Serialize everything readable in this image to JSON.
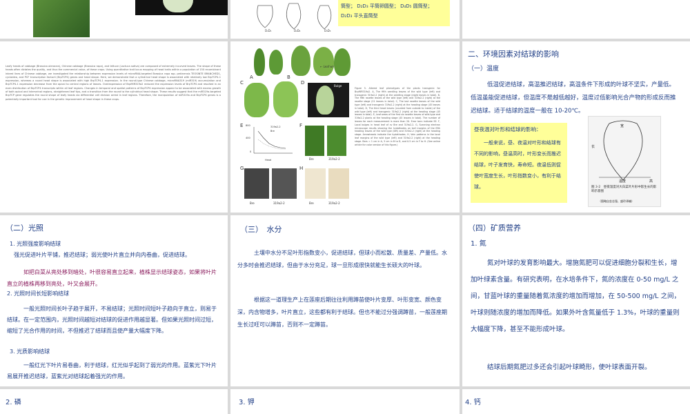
{
  "colors": {
    "title_blue": "#1f3e86",
    "body_blue": "#203880",
    "highlight": "#ffff99",
    "magenta": "#8a1b5c",
    "gray_bg": "#d9d9d9"
  },
  "top_strip": {
    "mid_lines": [
      "筒型；",
      "D₂D₃ 平筒卵圆型；",
      "D₄D₅ 圆筒型；"
    ],
    "mid_last": "D₂D₃ 平头直筒型",
    "head_labels": [
      "D₁D₁",
      "D₂D₂",
      "D₃D₃"
    ]
  },
  "abstract": {
    "text": "Leafy heads of cabbage (Brassica oleracea), Chinese cabbage (Brassica rapa), and lettuce (Lactuca sativa) are composed of extremely incurved leaves. The shape of these heads often dictates the quality, and thus the commercial value, of these crops. Using quantitative trait locus mapping of head traits within a population of 150 recombinant inbred lines of Chinese cabbage, we investigated the relationship between expression levels of microRNA-targeted Brassica rapa ssp. pekinensis TEOSINTE BRANCHED1, cycloidea, and PCF transcription factor4 (BrpTCP4) genes and head shape. Here, we demonstrate that a cylindrical head shape is associated with relatively low BrpTCP4-1 expression, whereas a round head shape is associated with high BrpTCP4-1 expression. In the round-type Chinese cabbage, microRNA319 (miR319) accumulation and BrpTCP4-1 expression decrease from the apical to central regions of leaves. Overexpression of BrpMIR319a2 reduced the expression levels of BrpTCP4 and resulted in an even distribution of BrpTCP4 transcripts within all leaf regions. Changes in temporal and spatial patterns of BrpTCP4 expression appear to be associated with excess growth of both apical and interveinal regions, straightened leaf tips, and a transition from the round to the cylindrical head shape. These results suggest that the miR319a-targeted BrpTCP gene regulates the round shape of leafy heads via differential cell division arrest in leaf regions. Therefore, the manipulation of miR319a and BrpTCP4 genes is a potentially important tool for use in the genetic improvement of head shape in these crops."
  },
  "figure": {
    "panel_letters": [
      "A",
      "B",
      "C",
      "D",
      "E",
      "F",
      "G",
      "H"
    ],
    "leaf_wing": "Leaf wing",
    "bulge": "Bulge",
    "vein": "Vein",
    "bre_label": "Bre",
    "mut_label": "319a2-2",
    "axis_y": "Leaf area (cm²)",
    "axis_x": "Head",
    "ticks_y": [
      "800",
      "600",
      "400",
      "200",
      "0"
    ],
    "ticks_x": [
      "1",
      "2",
      "3",
      "4",
      "5",
      "6"
    ],
    "legend": [
      "319a2-2",
      "Bre"
    ],
    "caption": "Figure 5. Altered leaf phenotypes of the plants transgenic for BrpMIR319a2. A, The fifth seedling leaves of the wild type (left) and transgenic 319a2-2 (right) at the seedling stage (eight leaves in total). B, The fifth rosette leaves of the wild type (left) and 319a2-2 (right) at the rosette stage (21 leaves in total). C, The last rosette leaves of the wild type (left) and transgenic 319a2-2 (right) at the heading stage (45 leaves in total). D, The third head leaves (counted from outside to inside) of the wild type (left) and transgenic 319a2-2 (right) at the heading stage (45 leaves in total). E, Leaf areas of the first six rosette leaves of wild-type and 319a2-2 plants at the heading stage (45 leaves in total). The number of leaves for each measurement is more than 20. Error bars indicate SE. F, Local bulges in head leaf of cv Bre and 319a2-2. G, Scanning electron microscope results showing the hydathodes on leaf margins of the fifth heading leaves of the wild type (left) and 319a2-2 (right) at the heading stage. Arrowheads indicate the hydathodes. H, Vein patterns in the local leaf margins of the wild type (left) and 319a2-2 (right) at the heading stage. Bars = 1 cm in A, 5 cm in B to D, and 0.5 cm in F to H. (See online article for color version of this figure.)"
  },
  "env": {
    "title": "二、环境因素对结球的影响",
    "subtitle": "（一）温度",
    "para": "低温促进结球，高温推迟结球，高温条件下形成的叶球不坚实，产量低。低温虽能促进结球，但温度不是越低越好，温度过低影响光合产物的形成反而推迟结球。适于结球的温度一般在 10-20℃。",
    "box_title": "昼夜温对叶形和结球的影响：",
    "box_text": "一般来说，昼、夜温对叶形和结球有不同的影响，昼温高时，叶形变长而推迟结球，叶子发育快，寿命短。夜温低则促使叶宽度生长，叶形指数变小，有利于结球。",
    "diagram_labels": [
      "长",
      "宽",
      "温度",
      "高"
    ],
    "diagram_caption": "图 3-2　昼夜温度对大白菜叶片形中影生长的影响示意图",
    "diagram_subcaption": "（图略自金志强、盛玲译编）"
  },
  "light": {
    "title": "（二）光照",
    "h1": "1. 光照强度影响结球",
    "p1": "强光促进叶片平铺，推迟结球；弱光使叶片直立并向内卷曲，促进结球。",
    "p_magenta": "如把白菜从亮处移到暗处，叶很容易直立起来，植株显示结球姿态，如果将叶片直立的植株再移到亮处，叶又会展开。",
    "h2": "2. 光照时间长短影响结球",
    "p2": "一般光照时间长叶子趋于展开，不易结球；光照时间短叶子趋向于直立，则易于结球。在一定范围内，光照时间越短对结球的促进作用越显著。但如果光照时间过短，缩短了光合作用的时间，不但推迟了结球而且使产量大幅度下降。",
    "h3": "3. 光质影响结球",
    "p3": "一般红光下叶片易卷曲，利于结球，红光似乎起到了弱光的作用。蓝紫光下叶片易展开推迟结球，蓝紫光对结球起着强光的作用。"
  },
  "water": {
    "title": "（三）　水分",
    "p1": "土壤中水分不足叶形指数变小，促进结球，但球小而松散、质量差、产量低。水分多时会推迟结球，但由于水分充足，球一旦形成很快就能生长硕大的叶球。",
    "p2": "根据这一道理生产上在莲座后期往往利用蹲苗使叶片变厚、叶形变宽、颜色变深，内含物增多，叶片直立，这些都有利于结球。但也不能过分强调蹲苗，一般莲座期生长过旺可以蹲苗，否则不一定蹲苗。"
  },
  "mineral": {
    "title": "（四）矿质营养",
    "h1": "1. 氮",
    "p1": "氮对叶球的发育影响最大。增施氮肥可以促进细胞分裂和生长，增加叶绿素含量。有研究表明，在水培条件下，氮的浓度在 0-50 mg/L 之间，甘蓝叶球的重量随着氮浓度的增加而增加，在 50-500 mg/L 之间，叶球则随浓度的增加而降低。如果外叶含氮量低于 1.3%，叶球的重量则大幅度下降，甚至不能形成叶球。",
    "p2": "结球后期氮肥过多还会引起叶球畸形，使叶球表面开裂。"
  },
  "bottom": {
    "phosphorus": "2. 磷",
    "potassium": "3. 钾",
    "calcium": "4. 钙"
  }
}
